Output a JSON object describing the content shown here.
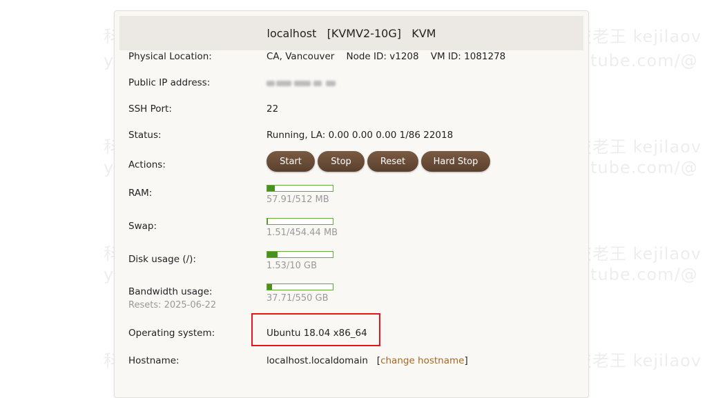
{
  "watermark": {
    "line1": "科技老王 kejilaowang.com",
    "line2": "youtube.com/@科技老王",
    "line1_cut": "科技老王 kejilaov",
    "line2_cut": "youtube.com/@"
  },
  "header": {
    "title": "localhost   [KVMV2-10G]   KVM"
  },
  "rows": {
    "location": {
      "label": "Physical Location:",
      "value": "CA, Vancouver    Node ID: v1208    VM ID: 1081278"
    },
    "ip": {
      "label": "Public IP address:"
    },
    "ssh": {
      "label": "SSH Port:",
      "value": "22"
    },
    "status": {
      "label": "Status:",
      "value": "Running, LA: 0.00 0.00 0.00 1/86 22018"
    },
    "actions": {
      "label": "Actions:",
      "buttons": [
        "Start",
        "Stop",
        "Reset",
        "Hard Stop"
      ]
    },
    "ram": {
      "label": "RAM:",
      "usage": "57.91/512 MB",
      "fraction": 0.113
    },
    "swap": {
      "label": "Swap:",
      "usage": "1.51/454.44 MB",
      "fraction": 0.003
    },
    "disk": {
      "label": "Disk usage (/):",
      "usage": "1.53/10 GB",
      "fraction": 0.153
    },
    "bandwidth": {
      "label": "Bandwidth usage:",
      "sublabel": "Resets: 2025-06-22",
      "usage": "37.71/550 GB",
      "fraction": 0.069
    },
    "os": {
      "label": "Operating system:",
      "value": "Ubuntu 18.04 x86_64"
    },
    "hostname": {
      "label": "Hostname:",
      "value": "localhost.localdomain",
      "link_open": "[",
      "link_text": "change hostname",
      "link_close": "]"
    }
  },
  "colors": {
    "button": "#6b4c36",
    "bar_fill": "#4d8f1e",
    "highlight": "#e0161a",
    "link": "#a0692a"
  }
}
